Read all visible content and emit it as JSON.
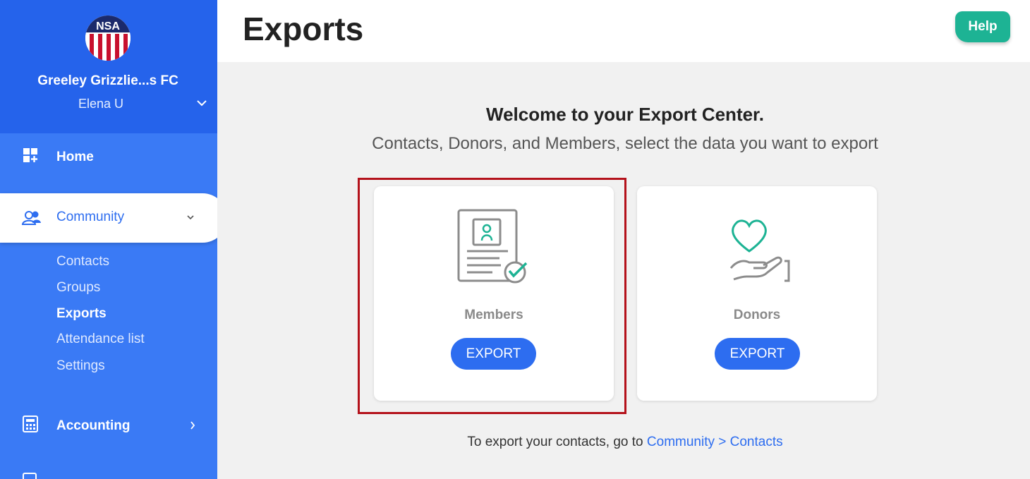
{
  "sidebar": {
    "org_name": "Greeley Grizzlie...s FC",
    "user_name": "Elena U",
    "nav": {
      "home": "Home",
      "community": "Community",
      "accounting": "Accounting"
    },
    "community_sub": [
      "Contacts",
      "Groups",
      "Exports",
      "Attendance list",
      "Settings"
    ],
    "active_sub": "Exports"
  },
  "header": {
    "title": "Exports",
    "help_label": "Help"
  },
  "main": {
    "welcome": "Welcome to your Export Center.",
    "subtitle": "Contacts, Donors, and Members, select the data you want to export",
    "cards": [
      {
        "label": "Members",
        "button": "EXPORT"
      },
      {
        "label": "Donors",
        "button": "EXPORT"
      }
    ],
    "footer_text": "To export your contacts, go to",
    "footer_link": "Community > Contacts"
  },
  "colors": {
    "sidebar": "#3a7af5",
    "sidebar_top": "#2563eb",
    "accent": "#2d6df0",
    "help": "#1db394",
    "highlight": "#b4121b",
    "teal_icon": "#1db394"
  }
}
